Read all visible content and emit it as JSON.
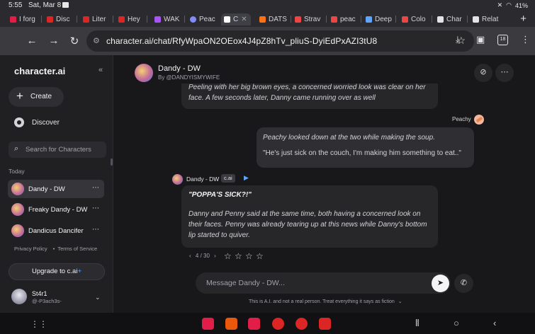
{
  "status_bar": {
    "time": "5:55",
    "date": "Sat, Mar 8",
    "battery": "41%"
  },
  "browser": {
    "tabs": [
      {
        "label": "I forg",
        "color": "#e11d48"
      },
      {
        "label": "Disc",
        "color": "#dc2626"
      },
      {
        "label": "Liter",
        "color": "#dc2626"
      },
      {
        "label": "Hey",
        "color": "#dc2626"
      },
      {
        "label": "WAK",
        "color": "#a855f7"
      },
      {
        "label": "Peac",
        "color": "#818cf8"
      },
      {
        "label": "C",
        "color": "#ffffff"
      },
      {
        "label": "DATS",
        "color": "#f97316"
      },
      {
        "label": "Strav",
        "color": "#ef4444"
      },
      {
        "label": "peac",
        "color": "#ef4444"
      },
      {
        "label": "Deep",
        "color": "#60a5fa"
      },
      {
        "label": "Colo",
        "color": "#ef4444"
      },
      {
        "label": "Char",
        "color": "#e4e4e7"
      },
      {
        "label": "Relat",
        "color": "#e4e4e7"
      }
    ],
    "new_tab": "+",
    "url": "character.ai/chat/RfyWpaON2OEox4J4pZ8hTv_pliuS-DyiEdPxAZI3tU8",
    "tab_count": "18"
  },
  "sidebar": {
    "brand": "character.ai",
    "create_label": "Create",
    "discover_label": "Discover",
    "search_placeholder": "Search for Characters",
    "section_today": "Today",
    "chats": [
      {
        "name": "Dandy - DW",
        "selected": true
      },
      {
        "name": "Freaky Dandy - DW",
        "selected": false
      },
      {
        "name": "Dandicus Dancifer",
        "selected": false
      }
    ],
    "privacy": "Privacy Policy",
    "terms": "Terms of Service",
    "upgrade_label": "Upgrade to c.ai",
    "upgrade_plus": "+",
    "user": {
      "name": "St4r1",
      "handle": "@-P3ach3s-"
    }
  },
  "header": {
    "name": "Dandy - DW",
    "by": "By @DANDYISMYWIFE"
  },
  "messages": {
    "previous_text": "Peeling with her big brown eyes, a concerned worried look was clear on her face. A few seconds later, Danny came running over as well",
    "user_label": "Peachy",
    "user_line1": "Peachy looked down at the two while making the soup.",
    "user_line2": "\"He's just sick on the couch, I'm making him something to eat..\"",
    "bot_name": "Dandy - DW",
    "bot_badge": "c.ai",
    "bot_head": "\"POPPA'S SICK?!\"",
    "bot_body": "Danny and Penny said at the same time, both having a concerned look on their faces. Penny was already tearing up at this news while Danny's bottom lip started to quiver.",
    "pager": "4 / 30"
  },
  "composer": {
    "placeholder": "Message Dandy - DW...",
    "disclaimer": "This is A.I. and not a real person. Treat everything it says as fiction"
  }
}
